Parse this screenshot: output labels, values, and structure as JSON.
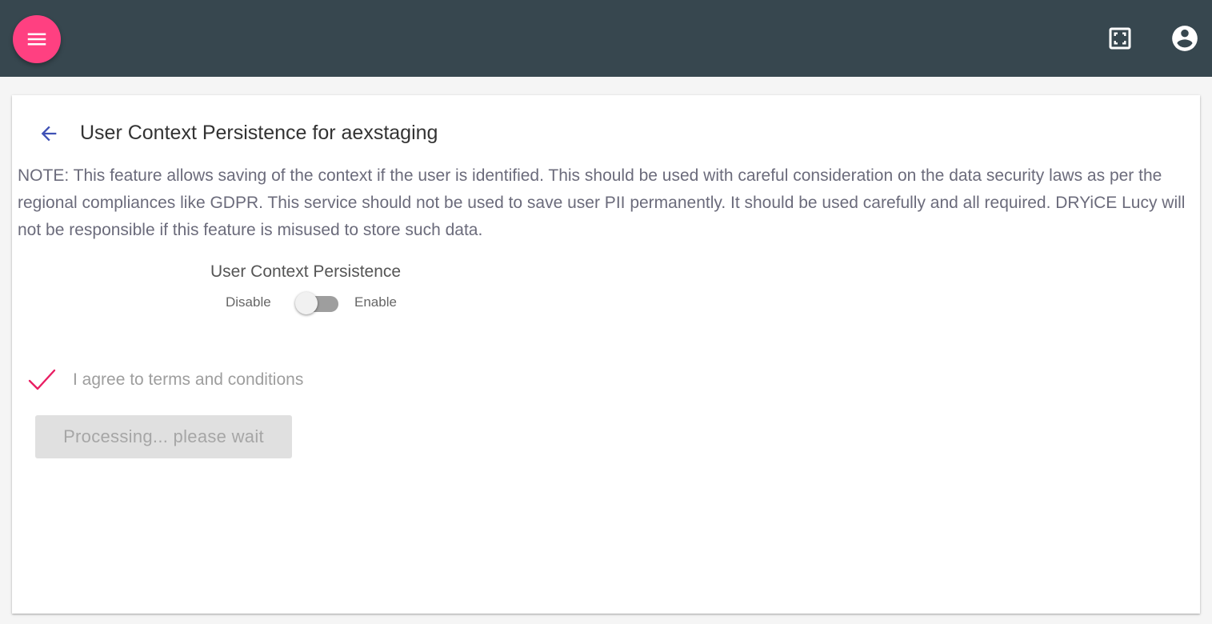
{
  "header": {
    "menu_icon": "menu-icon",
    "fullscreen_icon": "fullscreen-icon",
    "account_icon": "account-circle-icon",
    "bar_color": "#37474f",
    "accent_color": "#ff4081"
  },
  "page": {
    "back_icon": "arrow-back-icon",
    "title": "User Context Persistence for aexstaging",
    "note": "NOTE: This feature allows saving of the context if the user is identified. This should be used with careful consideration on the data security laws as per the regional compliances like GDPR. This service should not be used to save user PII permanently. It should be used carefully and all required. DRYiCE Lucy will not be responsible if this feature is misused to store such data."
  },
  "persistence": {
    "title": "User Context Persistence",
    "off_label": "Disable",
    "on_label": "Enable",
    "enabled": false
  },
  "terms": {
    "label": "I agree to terms and conditions",
    "checked": true,
    "check_color": "#e91e63"
  },
  "submit": {
    "label": "Processing... please wait",
    "disabled": true
  }
}
